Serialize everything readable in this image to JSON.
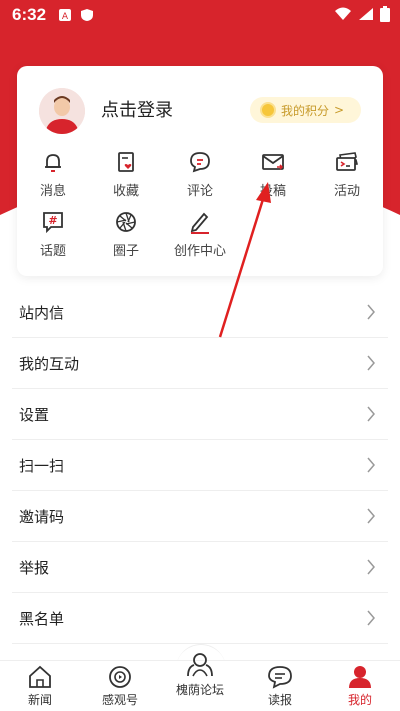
{
  "colors": {
    "brand_red": "#d7242c",
    "coin": "#f6c63a",
    "points_bg": "#fff6d9"
  },
  "status_bar": {
    "time": "6:32"
  },
  "profile": {
    "login_label": "点击登录",
    "points_label": "我的积分",
    "points_chevron": ">"
  },
  "grid": [
    {
      "label": "消息",
      "icon": "bell-icon"
    },
    {
      "label": "收藏",
      "icon": "favorite-icon"
    },
    {
      "label": "评论",
      "icon": "comment-icon"
    },
    {
      "label": "投稿",
      "icon": "mail-submit-icon"
    },
    {
      "label": "活动",
      "icon": "ticket-icon"
    },
    {
      "label": "话题",
      "icon": "hashtag-icon"
    },
    {
      "label": "圈子",
      "icon": "aperture-icon"
    },
    {
      "label": "创作中心",
      "icon": "pen-icon"
    }
  ],
  "menu": [
    {
      "label": "站内信"
    },
    {
      "label": "我的互动"
    },
    {
      "label": "设置"
    },
    {
      "label": "扫一扫"
    },
    {
      "label": "邀请码"
    },
    {
      "label": "举报"
    },
    {
      "label": "黑名单"
    }
  ],
  "bottom_nav": [
    {
      "label": "新闻",
      "icon": "home-icon"
    },
    {
      "label": "感观号",
      "icon": "eye-play-icon"
    },
    {
      "label": "槐荫论坛",
      "icon": "forum-icon"
    },
    {
      "label": "读报",
      "icon": "chat-bubble-icon"
    },
    {
      "label": "我的",
      "icon": "person-icon",
      "active": true
    }
  ]
}
